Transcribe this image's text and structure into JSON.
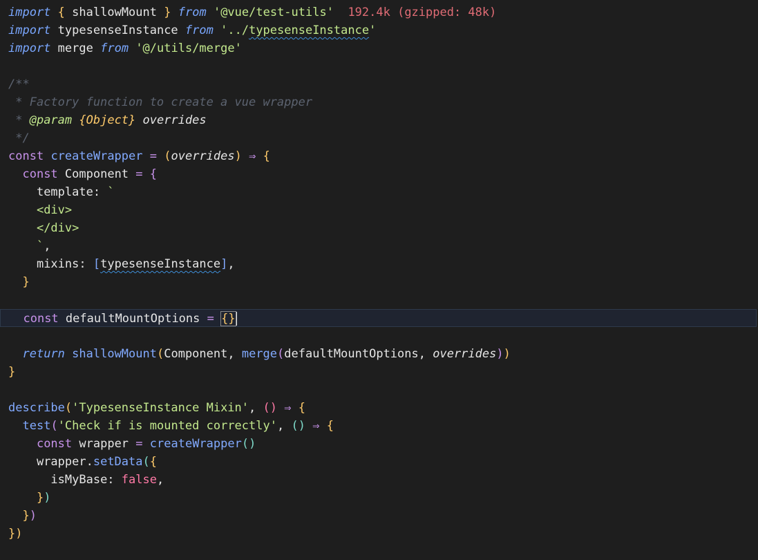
{
  "code": {
    "l1": {
      "import": "import",
      "ob": "{",
      "name": "shallowMount",
      "cb": "}",
      "from": "from",
      "src": "'@vue/test-utils'",
      "hint": "192.4k (gzipped: 48k)"
    },
    "l2": {
      "import": "import",
      "name": "typesenseInstance",
      "from": "from",
      "src_a": "'../",
      "src_b": "typesenseInstance",
      "src_c": "'"
    },
    "l3": {
      "import": "import",
      "name": "merge",
      "from": "from",
      "src": "'@/utils/merge'"
    },
    "l5": {
      "text": "/**"
    },
    "l6": {
      "text": " * Factory function to create a vue wrapper"
    },
    "l7": {
      "star": " * ",
      "tag": "@param",
      "type": "{Object}",
      "param": "overrides"
    },
    "l8": {
      "text": " */"
    },
    "l9": {
      "const": "const",
      "name": "createWrapper",
      "eq": "=",
      "op": "(",
      "param": "overrides",
      "cp": ")",
      "arrow": "⇒",
      "ob": "{"
    },
    "l10": {
      "const": "const",
      "name": "Component",
      "eq": "=",
      "ob": "{"
    },
    "l11": {
      "prop": "template:",
      "tick": "`"
    },
    "l12": {
      "text": "<div>"
    },
    "l13": {
      "text": "</div>"
    },
    "l14": {
      "tick": "`",
      "comma": ","
    },
    "l15": {
      "prop": "mixins:",
      "ob": "[",
      "name": "typesenseInstance",
      "cb": "]",
      "comma": ","
    },
    "l16": {
      "cb": "}"
    },
    "l18": {
      "const": "const",
      "name": "defaultMountOptions",
      "eq": "=",
      "obj": "{}"
    },
    "l20": {
      "ret": "return",
      "fn": "shallowMount",
      "op": "(",
      "a1": "Component,",
      "fn2": "merge",
      "op2": "(",
      "a2": "defaultMountOptions,",
      "a3": "overrides",
      "cp2": ")",
      "cp": ")"
    },
    "l21": {
      "cb": "}"
    },
    "l23": {
      "fn": "describe",
      "op": "(",
      "str": "'TypesenseInstance Mixin'",
      "comma": ",",
      "ep": "()",
      "arrow": "⇒",
      "ob": "{"
    },
    "l24": {
      "fn": "test",
      "op": "(",
      "str": "'Check if is mounted correctly'",
      "comma": ",",
      "ep": "()",
      "arrow": "⇒",
      "ob": "{"
    },
    "l25": {
      "const": "const",
      "name": "wrapper",
      "eq": "=",
      "fn": "createWrapper",
      "ep": "()"
    },
    "l26": {
      "obj": "wrapper.",
      "fn": "setData",
      "op": "(",
      "ob": "{"
    },
    "l27": {
      "prop": "isMyBase:",
      "val": "false",
      "comma": ","
    },
    "l28": {
      "cb": "}",
      "cp": ")"
    },
    "l29": {
      "cb": "}",
      "cp": ")"
    },
    "l30": {
      "cb": "}",
      "cp": ")"
    }
  }
}
